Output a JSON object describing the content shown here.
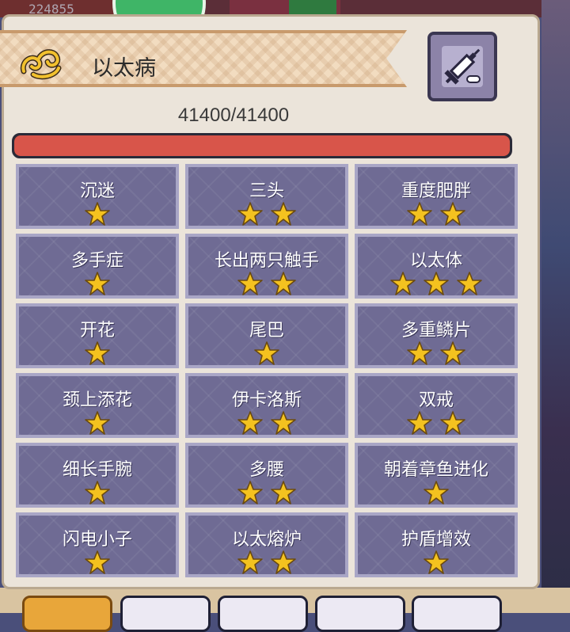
{
  "background": {
    "score": "224855"
  },
  "disease": {
    "title": "以太病",
    "hp_text": "41400/41400",
    "hp_fraction": 1.0
  },
  "icons": {
    "ribbon": "flourish-icon",
    "inject": "syringe-icon",
    "star": "star-icon"
  },
  "colors": {
    "hp_fill": "#d8554a",
    "tile": "#6f6b94",
    "star": "#f4c21f"
  },
  "traits": [
    {
      "name": "沉迷",
      "stars": 1
    },
    {
      "name": "三头",
      "stars": 2
    },
    {
      "name": "重度肥胖",
      "stars": 2
    },
    {
      "name": "多手症",
      "stars": 1
    },
    {
      "name": "长出两只触手",
      "stars": 2
    },
    {
      "name": "以太体",
      "stars": 3
    },
    {
      "name": "开花",
      "stars": 1
    },
    {
      "name": "尾巴",
      "stars": 1
    },
    {
      "name": "多重鳞片",
      "stars": 2
    },
    {
      "name": "颈上添花",
      "stars": 1
    },
    {
      "name": "伊卡洛斯",
      "stars": 2
    },
    {
      "name": "双戒",
      "stars": 2
    },
    {
      "name": "细长手腕",
      "stars": 1
    },
    {
      "name": "多腰",
      "stars": 2
    },
    {
      "name": "朝着章鱼进化",
      "stars": 1
    },
    {
      "name": "闪电小子",
      "stars": 1
    },
    {
      "name": "以太熔炉",
      "stars": 2
    },
    {
      "name": "护盾增效",
      "stars": 1
    }
  ]
}
